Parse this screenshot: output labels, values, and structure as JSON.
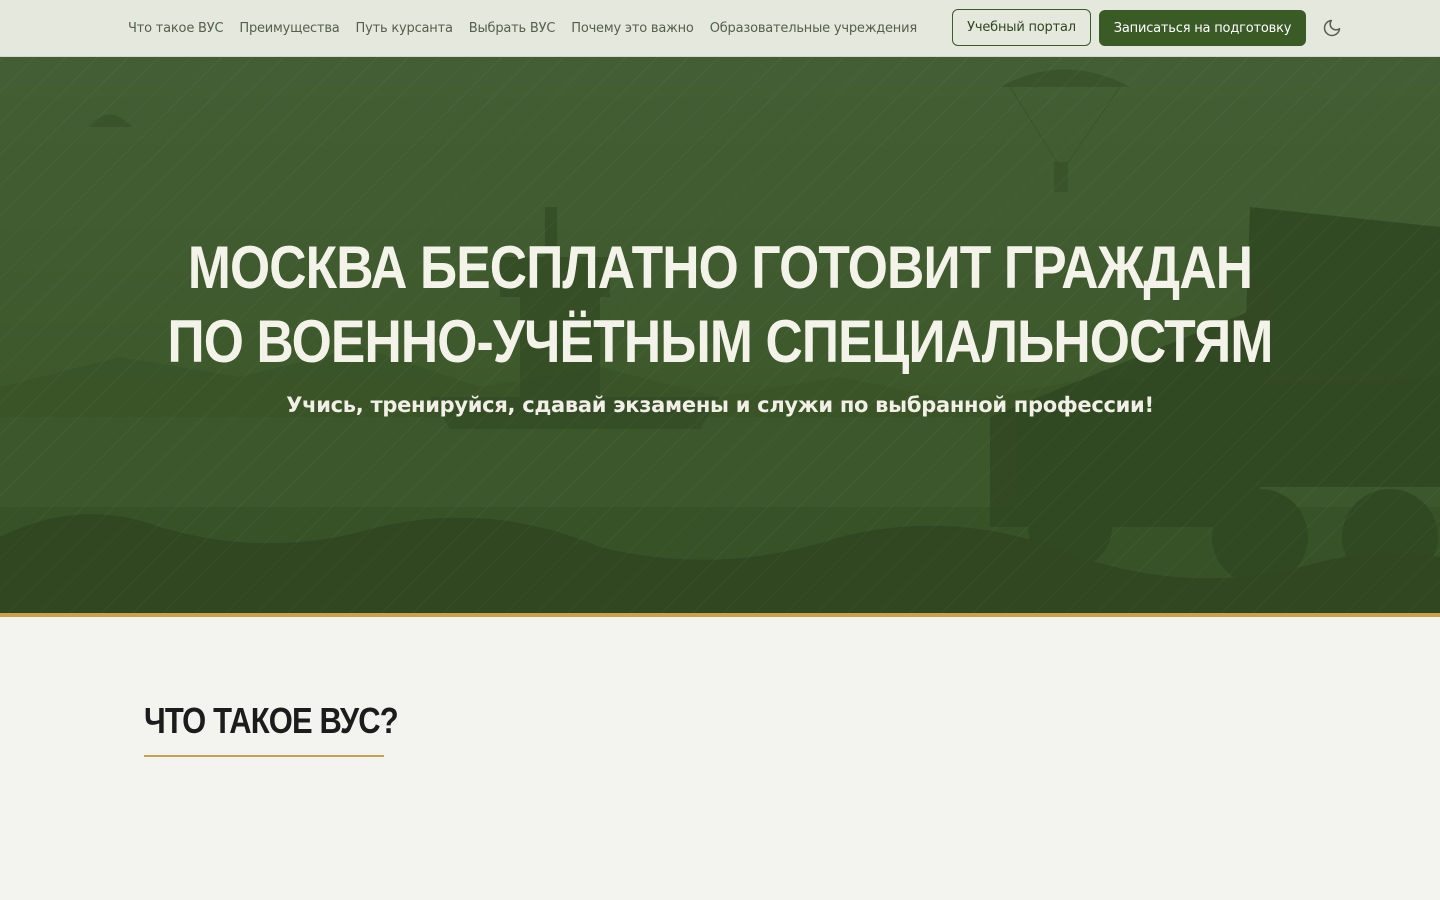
{
  "nav": {
    "links": [
      {
        "label": "Что такое ВУС"
      },
      {
        "label": "Преимущества"
      },
      {
        "label": "Путь курсанта"
      },
      {
        "label": "Выбрать ВУС"
      },
      {
        "label": "Почему это важно"
      },
      {
        "label": "Образовательные учреждения"
      }
    ],
    "portal_button": "Учебный портал",
    "signup_button": "Записаться на подготовку",
    "theme_toggle_icon": "moon-icon"
  },
  "hero": {
    "title_line1": "Москва бесплатно готовит граждан",
    "title_line2": "по военно-учётным специальностям",
    "subtitle": "Учись, тренируйся, сдавай экзамены и служи по выбранной профессии!"
  },
  "section": {
    "title": "Что такое ВУС?"
  },
  "colors": {
    "header_bg": "#e5e8dd",
    "accent_green": "#3a5a26",
    "hero_tint": "#3f5a2c",
    "gold_accent": "#c9a24e",
    "page_bg": "#f3f3ef"
  }
}
